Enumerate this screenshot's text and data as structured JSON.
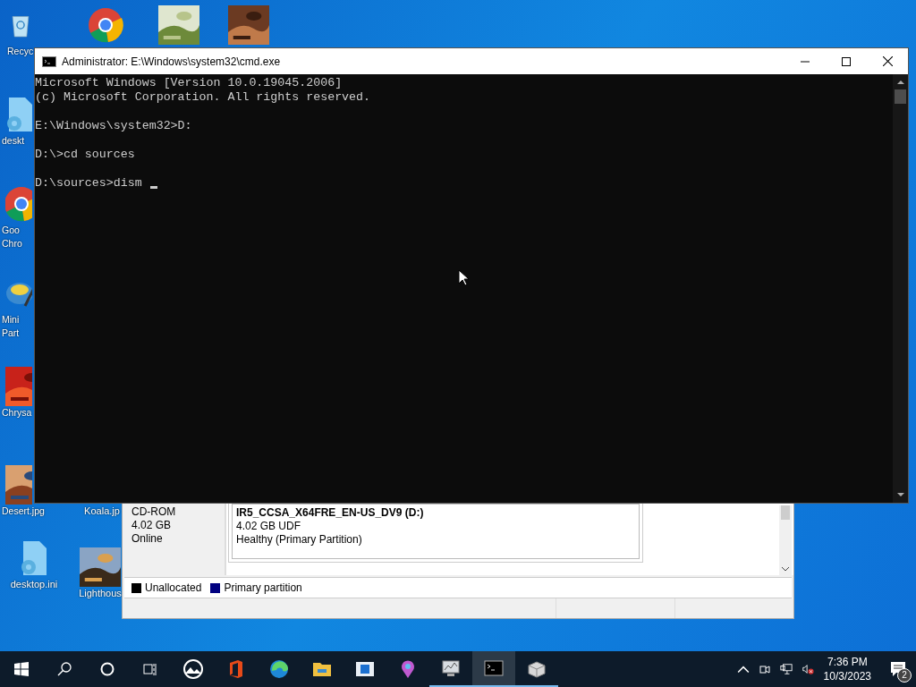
{
  "desktop_icons": [
    {
      "kind": "recycle",
      "lines": [
        "Recyc"
      ]
    },
    {
      "kind": "chrome"
    },
    {
      "kind": "picture"
    },
    {
      "kind": "picture"
    },
    {
      "kind": "settings-file",
      "lines": [
        "deskt"
      ]
    },
    {
      "kind": "chrome",
      "lines": [
        "Goo",
        "Chro"
      ]
    },
    {
      "kind": "partition-tool",
      "lines": [
        "Mini",
        "Part"
      ]
    },
    {
      "kind": "picture",
      "lines": [
        "Chrysa"
      ]
    },
    {
      "kind": "picture",
      "lines": [
        "Desert.jpg"
      ]
    },
    {
      "kind": "hidden",
      "lines": [
        "Koala.jp"
      ]
    },
    {
      "kind": "settings-file",
      "lines": [
        "desktop.ini"
      ]
    },
    {
      "kind": "picture",
      "lines": [
        "Lighthous"
      ]
    }
  ],
  "disk_window": {
    "disk": [
      "CD-ROM",
      "4.02 GB",
      "Online"
    ],
    "partition": {
      "name": "IR5_CCSA_X64FRE_EN-US_DV9  (D:)",
      "lines": [
        "4.02 GB UDF",
        "Healthy (Primary Partition)"
      ]
    },
    "legend": [
      {
        "label": "Unallocated",
        "color": "#000000"
      },
      {
        "label": "Primary partition",
        "color": "#000080"
      }
    ]
  },
  "cmd_window": {
    "title": "Administrator: E:\\Windows\\system32\\cmd.exe",
    "blocks": [
      [
        "Microsoft Windows [Version 10.0.19045.2006]",
        "(c) Microsoft Corporation. All rights reserved."
      ],
      [
        "E:\\Windows\\system32>D:"
      ],
      [
        "D:\\>cd sources"
      ],
      [
        "D:\\sources>dism "
      ]
    ]
  },
  "taskbar": {
    "apps": [
      {
        "kind": "photos",
        "running": false,
        "selected": false
      },
      {
        "kind": "office",
        "running": false,
        "selected": false
      },
      {
        "kind": "edge",
        "running": false,
        "selected": false
      },
      {
        "kind": "explorer",
        "running": false,
        "selected": false
      },
      {
        "kind": "blue-window",
        "running": false,
        "selected": false
      },
      {
        "kind": "paint",
        "running": false,
        "selected": false
      },
      {
        "kind": "monitor",
        "running": true,
        "selected": false
      },
      {
        "kind": "terminal",
        "running": true,
        "selected": true
      },
      {
        "kind": "package",
        "running": true,
        "selected": false
      }
    ],
    "time": "7:36 PM",
    "date": "10/3/2023",
    "notifications": "2"
  }
}
